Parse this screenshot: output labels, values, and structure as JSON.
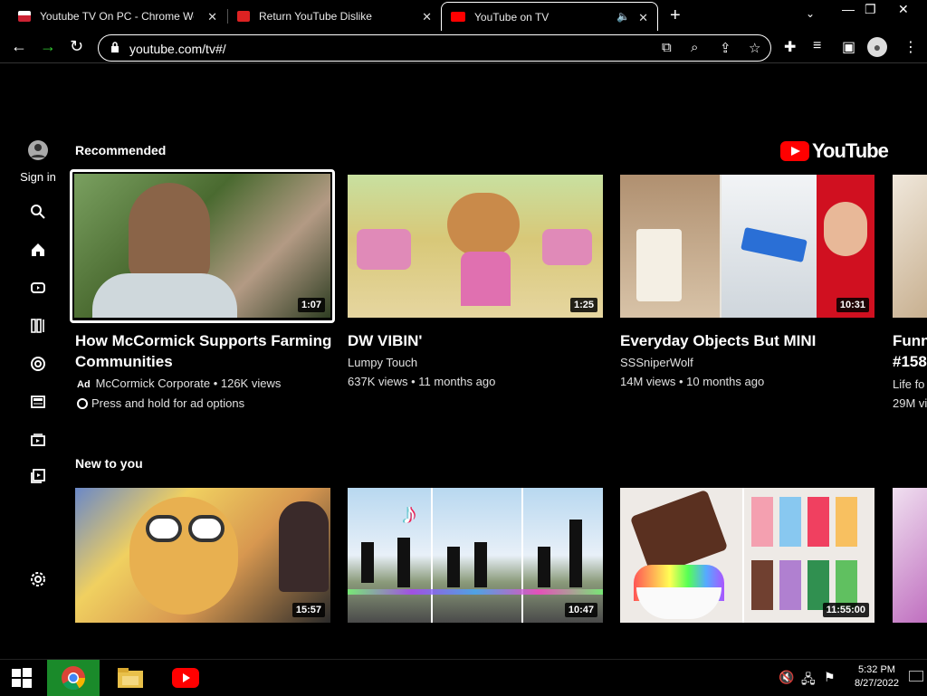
{
  "browser": {
    "tabs": [
      {
        "title": "Youtube TV On PC - Chrome Web Store",
        "favicon_color": "#c23"
      },
      {
        "title": "Return YouTube Dislike",
        "favicon_color": "#d22"
      },
      {
        "title": "YouTube on TV",
        "favicon_color": "#f00",
        "active": true
      }
    ],
    "url": "youtube.com/tv#/"
  },
  "sidebar": {
    "sign_in": "Sign in",
    "items": [
      "account-icon",
      "search-icon",
      "home-icon",
      "shorts-icon",
      "library-icon",
      "trending-icon",
      "subscriptions-icon",
      "gaming-icon",
      "queue-icon",
      "settings-icon"
    ]
  },
  "logo": {
    "word": "YouTube"
  },
  "shelves": [
    {
      "title": "Recommended",
      "videos": [
        {
          "title": "How McCormick Supports Farming Communities",
          "channel": "McCormick Corporate • 126K views",
          "ad": "Ad",
          "extra": "Press and hold for ad options",
          "duration": "1:07",
          "colors": [
            "#6a8a4a",
            "#3c5a2a",
            "#b8a08a"
          ]
        },
        {
          "title": "DW VIBIN'",
          "channel": "Lumpy Touch",
          "meta": "637K views • 11 months ago",
          "duration": "1:25",
          "colors": [
            "#d8c878",
            "#7fc4a0",
            "#e08ab8"
          ]
        },
        {
          "title": "Everyday Objects But MINI",
          "channel": "SSSniperWolf",
          "meta": "14M views • 10 months ago",
          "duration": "10:31",
          "colors": [
            "#d9c3a8",
            "#e0e8f0",
            "#d01020"
          ]
        },
        {
          "title": "Funn #158",
          "channel": "Life fo",
          "meta": "29M vi",
          "duration": "",
          "colors": [
            "#e8dcc8",
            "#c8b090",
            "#f0e8dc"
          ]
        }
      ]
    },
    {
      "title": "New to you",
      "videos": [
        {
          "duration": "15:57",
          "colors": [
            "#f0d060",
            "#c04030",
            "#6080c0"
          ]
        },
        {
          "duration": "10:47",
          "colors": [
            "#a8c8e8",
            "#406040",
            "#202020"
          ]
        },
        {
          "duration": "11:55:00",
          "colors": [
            "#f0f0f0",
            "#603828",
            "#e8b0c0"
          ]
        },
        {
          "duration": "",
          "colors": [
            "#e8c0e8",
            "#c080c0",
            "#f0f0f0"
          ]
        }
      ]
    }
  ],
  "taskbar": {
    "time": "5:32 PM",
    "date": "8/27/2022"
  }
}
